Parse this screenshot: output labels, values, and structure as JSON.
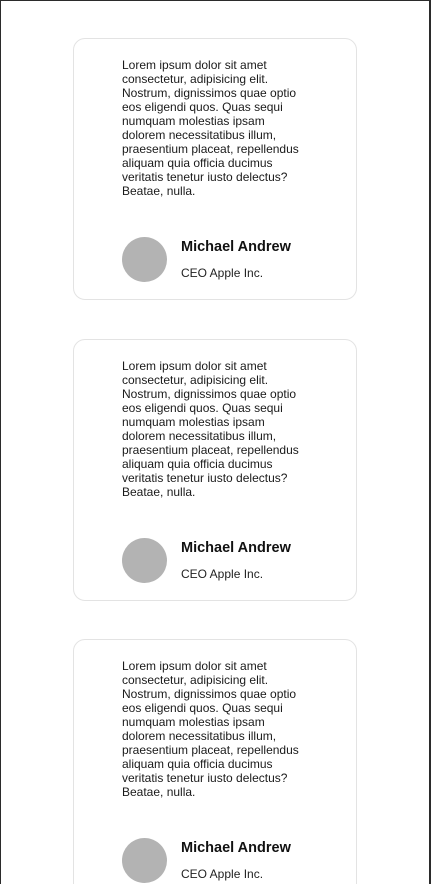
{
  "testimonials": [
    {
      "text": "Lorem ipsum dolor sit amet consectetur, adipisicing elit. Nostrum, dignissimos quae optio eos eligendi quos. Quas sequi numquam molestias ipsam dolorem necessitatibus illum, praesentium placeat, repellendus aliquam quia officia ducimus veritatis tenetur iusto delectus? Beatae, nulla.",
      "name": "Michael Andrew",
      "title": "CEO Apple Inc."
    },
    {
      "text": "Lorem ipsum dolor sit amet consectetur, adipisicing elit. Nostrum, dignissimos quae optio eos eligendi quos. Quas sequi numquam molestias ipsam dolorem necessitatibus illum, praesentium placeat, repellendus aliquam quia officia ducimus veritatis tenetur iusto delectus? Beatae, nulla.",
      "name": "Michael Andrew",
      "title": "CEO Apple Inc."
    },
    {
      "text": "Lorem ipsum dolor sit amet consectetur, adipisicing elit. Nostrum, dignissimos quae optio eos eligendi quos. Quas sequi numquam molestias ipsam dolorem necessitatibus illum, praesentium placeat, repellendus aliquam quia officia ducimus veritatis tenetur iusto delectus? Beatae, nulla.",
      "name": "Michael Andrew",
      "title": "CEO Apple Inc."
    }
  ],
  "colors": {
    "avatar_placeholder": "#b3b3b3",
    "card_border": "#e3e3e3",
    "text": "#1a1a1a"
  }
}
